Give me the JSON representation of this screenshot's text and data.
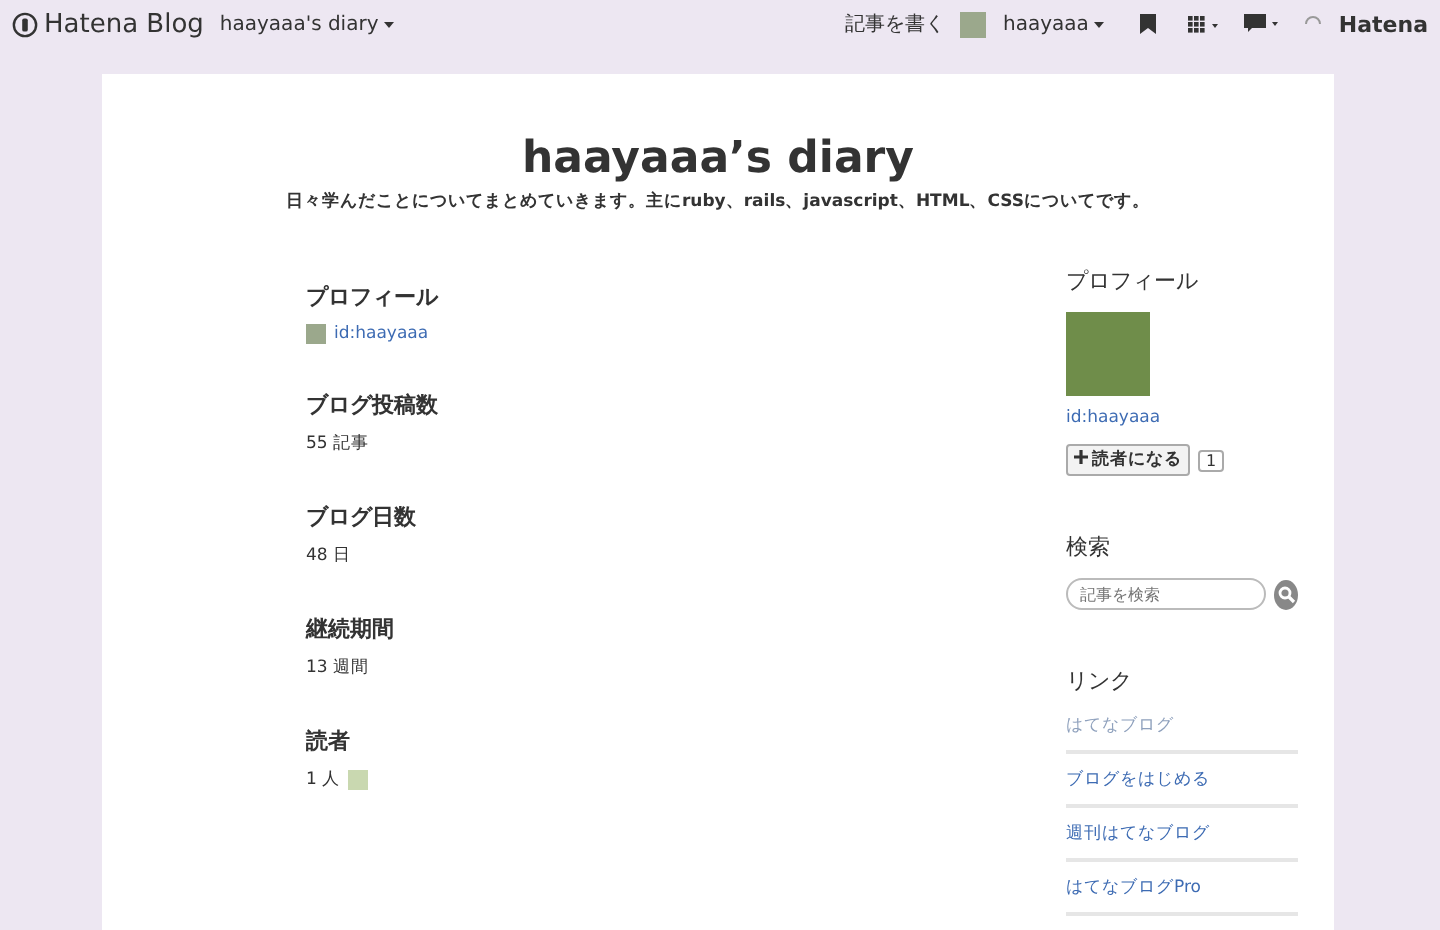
{
  "topbar": {
    "logo": "Hatena Blog",
    "blog_menu": "haayaaa's diary",
    "write": "記事を書く",
    "user": "haayaaa",
    "brand": "Hatena"
  },
  "header": {
    "title": "haayaaa’s diary",
    "description": "日々学んだことについてまとめていきます。主にruby、rails、javascript、HTML、CSSについてです。"
  },
  "about": {
    "profile_heading": "プロフィール",
    "profile_id": "id:haayaaa",
    "stats": [
      {
        "heading": "ブログ投稿数",
        "value": "55 記事"
      },
      {
        "heading": "ブログ日数",
        "value": "48 日"
      },
      {
        "heading": "継続期間",
        "value": "13 週間"
      },
      {
        "heading": "読者",
        "value": "1 人"
      }
    ]
  },
  "sidebar": {
    "profile_heading": "プロフィール",
    "profile_id": "id:haayaaa",
    "subscribe": "読者になる",
    "subscriber_count": "1",
    "search_heading": "検索",
    "search": {
      "placeholder": "記事を検索"
    },
    "links_heading": "リンク",
    "links": [
      {
        "label": "はてなブログ",
        "visited": true
      },
      {
        "label": "ブログをはじめる",
        "visited": false
      },
      {
        "label": "週刊はてなブログ",
        "visited": false
      },
      {
        "label": "はてなブログPro",
        "visited": false
      }
    ]
  }
}
